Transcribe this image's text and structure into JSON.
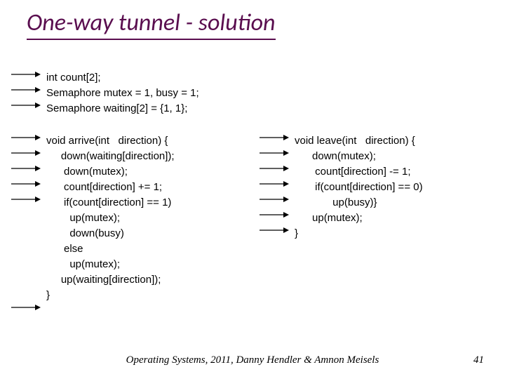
{
  "title": "One-way tunnel - solution",
  "decl": {
    "line1": "int count[2];",
    "line2": "Semaphore mutex = 1, busy = 1;",
    "line3": "Semaphore waiting[2] = {1, 1};"
  },
  "arrive": {
    "l0": "void arrive(int   direction) {",
    "l1": "     down(waiting[direction]);",
    "l2": "      down(mutex);",
    "l3": "      count[direction] += 1;",
    "l4": "      if(count[direction] == 1)",
    "l5": "        up(mutex);",
    "l6": "        down(busy)",
    "l7": "      else",
    "l8": "        up(mutex);",
    "l9": "     up(waiting[direction]);",
    "l10": "}"
  },
  "leave": {
    "l0": "void leave(int   direction) {",
    "l1": "      down(mutex);",
    "l2": "       count[direction] -= 1;",
    "l3": "       if(count[direction] == 0)",
    "l4": "             up(busy)}",
    "l5": "      up(mutex);",
    "l6": "}"
  },
  "footer": "Operating Systems, 2011, Danny Hendler & Amnon Meisels",
  "page": "41",
  "arrows": {
    "decl_y": [
      100,
      122,
      144
    ],
    "arrive_y": [
      190,
      212,
      234,
      256,
      278,
      432
    ],
    "leave_y": [
      190,
      212,
      234,
      256,
      278,
      300,
      322
    ]
  }
}
